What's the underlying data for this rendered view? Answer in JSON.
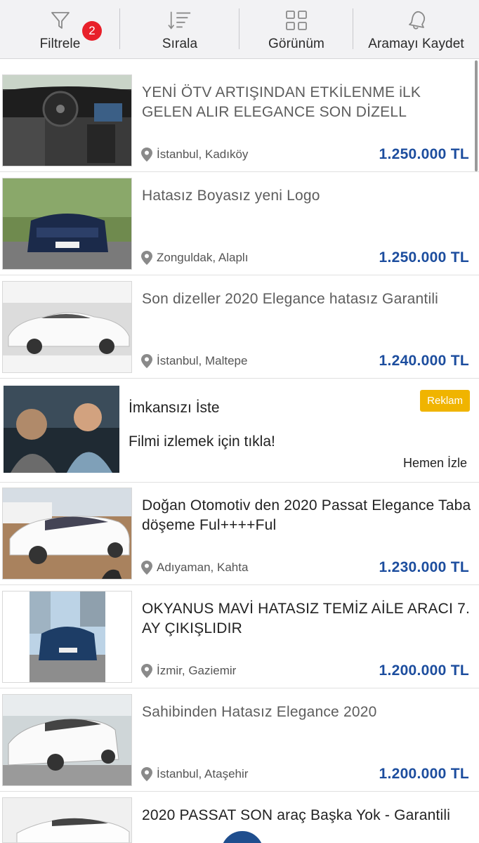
{
  "toolbar": {
    "filter": {
      "label": "Filtrele",
      "icon": "filter-icon",
      "badge": "2"
    },
    "sort": {
      "label": "Sırala",
      "icon": "sort-icon"
    },
    "view": {
      "label": "Görünüm",
      "icon": "grid-icon"
    },
    "save": {
      "label": "Aramayı Kaydet",
      "icon": "bell-icon"
    }
  },
  "listings": [
    {
      "title": "YENİ ÖTV ARTIŞINDAN ETKİLENME iLK GELEN ALIR ELEGANCE SON DİZELL",
      "location": "İstanbul, Kadıköy",
      "price": "1.250.000 TL"
    },
    {
      "title": "Hatasız Boyasız yeni Logo",
      "location": "Zonguldak, Alaplı",
      "price": "1.250.000 TL"
    },
    {
      "title": "Son dizeller 2020 Elegance hatasız Garantili",
      "location": "İstanbul, Maltepe",
      "price": "1.240.000 TL"
    },
    {
      "title": "Doğan Otomotiv den 2020 Passat Elegance Taba döşeme Ful++++Ful",
      "location": "Adıyaman, Kahta",
      "price": "1.230.000 TL"
    },
    {
      "title": "OKYANUS MAVİ HATASIZ TEMİZ AİLE ARACI 7. AY ÇIKIŞLIDIR",
      "location": "İzmir, Gaziemir",
      "price": "1.200.000 TL"
    },
    {
      "title": "Sahibinden Hatasız Elegance 2020",
      "location": "İstanbul, Ataşehir",
      "price": "1.200.000 TL"
    },
    {
      "title": "2020 PASSAT SON araç Başka Yok - Garantili",
      "location": "",
      "price": ""
    }
  ],
  "ad": {
    "title": "İmkansızı İste",
    "subtitle": "Filmi izlemek için tıkla!",
    "cta": "Hemen İzle",
    "badge": "Reklam"
  },
  "colors": {
    "price": "#1c4d9e",
    "badge": "#e8202a",
    "ad_badge": "#f0b400"
  }
}
